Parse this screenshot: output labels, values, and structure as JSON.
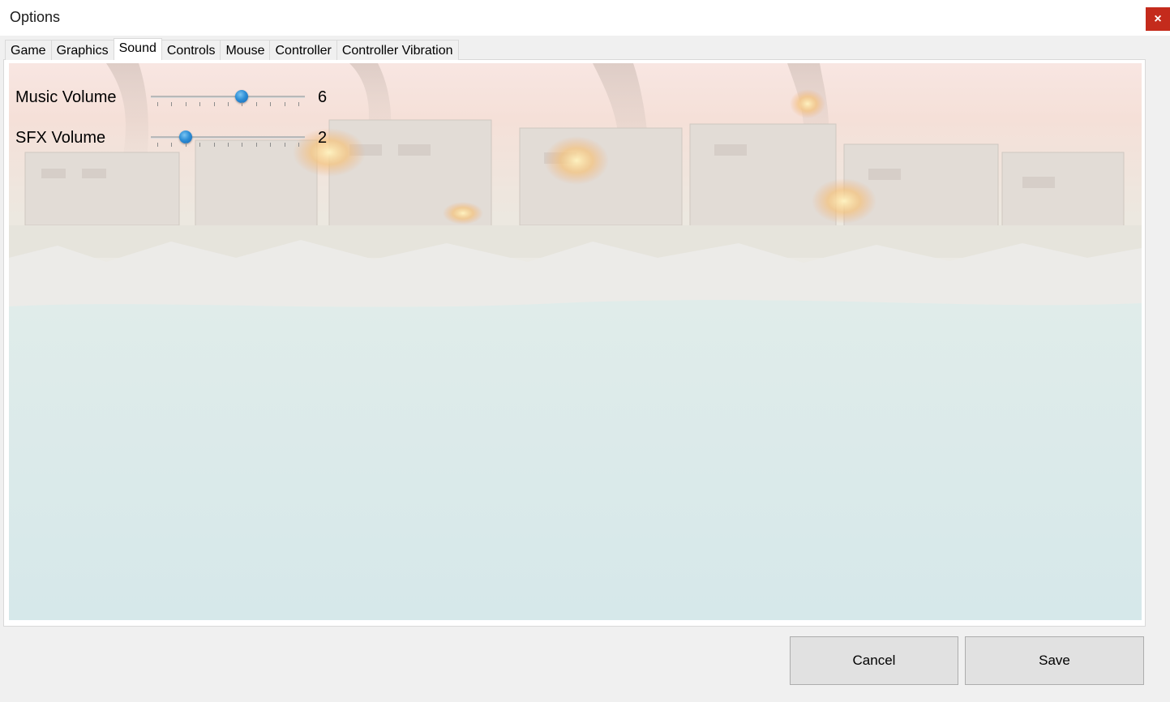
{
  "window": {
    "title": "Options",
    "close_label": "×"
  },
  "tabs": [
    {
      "label": "Game",
      "active": false
    },
    {
      "label": "Graphics",
      "active": false
    },
    {
      "label": "Sound",
      "active": true
    },
    {
      "label": "Controls",
      "active": false
    },
    {
      "label": "Mouse",
      "active": false
    },
    {
      "label": "Controller",
      "active": false
    },
    {
      "label": "Controller Vibration",
      "active": false
    }
  ],
  "sound": {
    "music": {
      "label": "Music Volume",
      "value": "6",
      "level": 6,
      "max": 10
    },
    "sfx": {
      "label": "SFX Volume",
      "value": "2",
      "level": 2,
      "max": 10
    }
  },
  "buttons": {
    "cancel_label": "Cancel",
    "save_label": "Save"
  },
  "colors": {
    "close_button": "#c42b1c",
    "slider_thumb": "#2f8fd6"
  },
  "background": {
    "description_icon": "seaside-city-ruins-background-image"
  }
}
